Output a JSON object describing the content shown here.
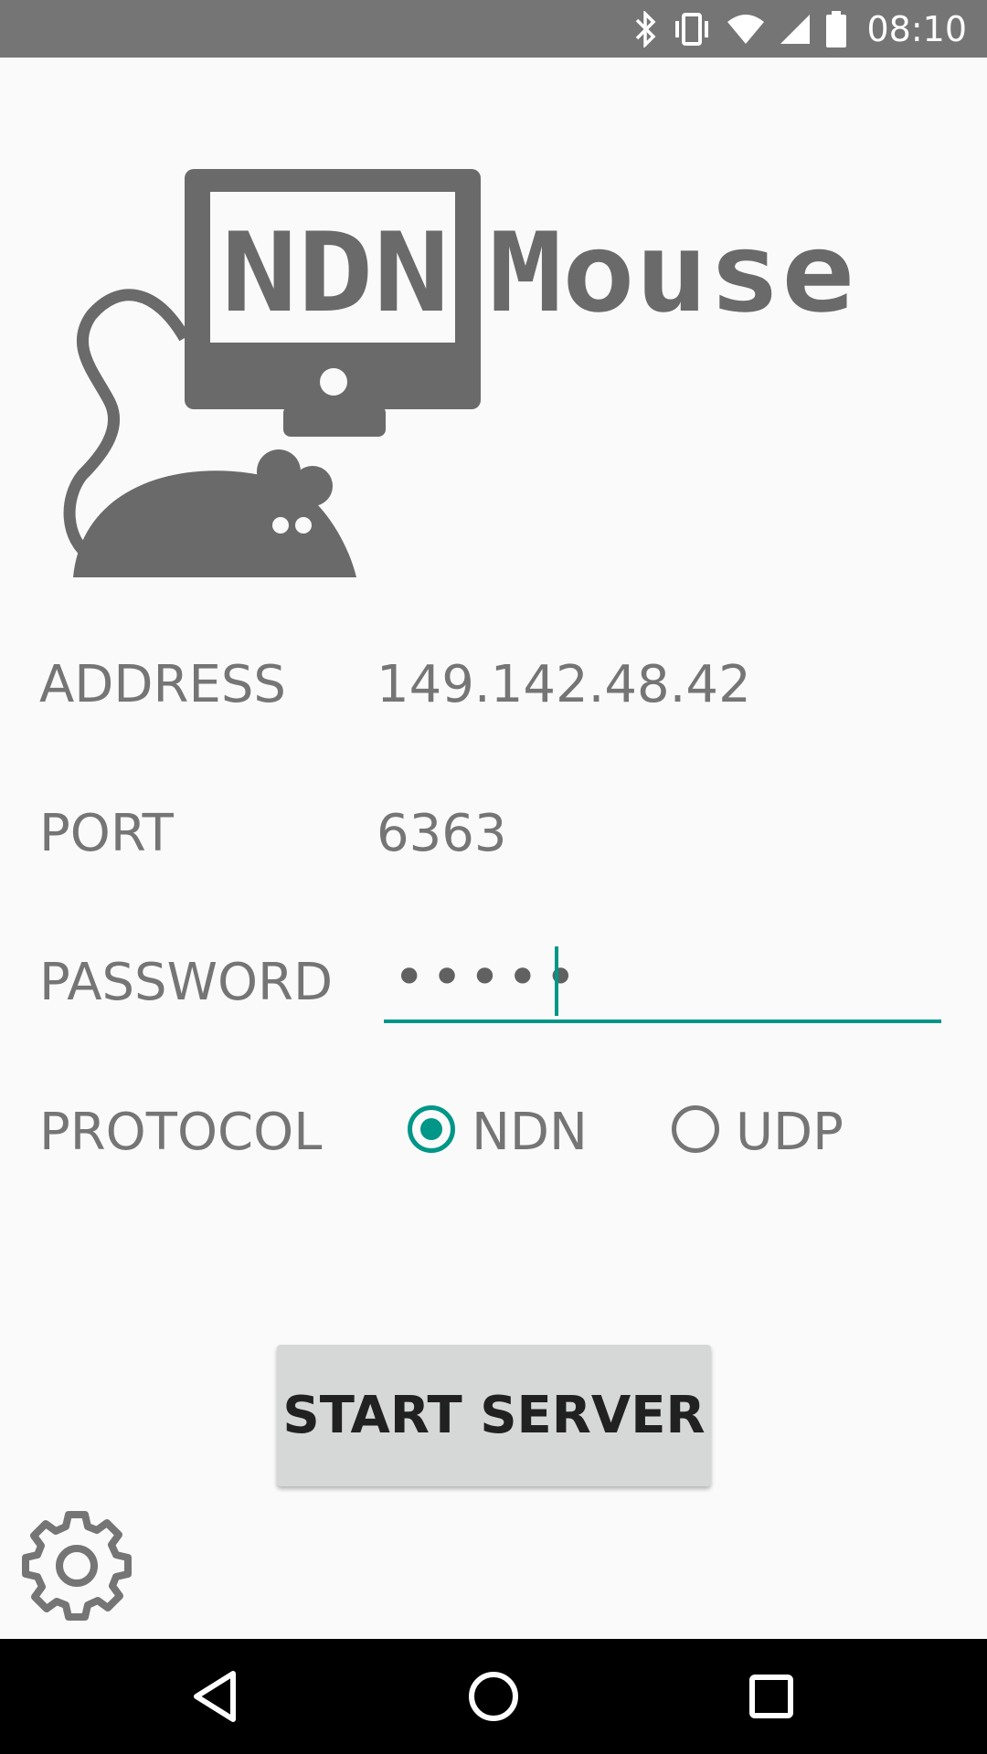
{
  "status_bar": {
    "time": "08:10",
    "icons": [
      "bluetooth-icon",
      "vibrate-icon",
      "wifi-icon",
      "cell-signal-icon",
      "battery-icon"
    ]
  },
  "logo": {
    "text_boxed": "NDN",
    "text": "Mouse"
  },
  "form": {
    "address_label": "ADDRESS",
    "address_value": "149.142.48.42",
    "port_label": "PORT",
    "port_value": "6363",
    "password_label": "PASSWORD",
    "password_value": "•••••",
    "protocol_label": "PROTOCOL",
    "protocol_options": [
      {
        "label": "NDN",
        "selected": true
      },
      {
        "label": "UDP",
        "selected": false
      }
    ]
  },
  "actions": {
    "start_label": "START SERVER"
  },
  "colors": {
    "accent": "#009688",
    "text_gray": "#757575",
    "status_bar": "#757575",
    "button_bg": "#d6d7d7"
  }
}
